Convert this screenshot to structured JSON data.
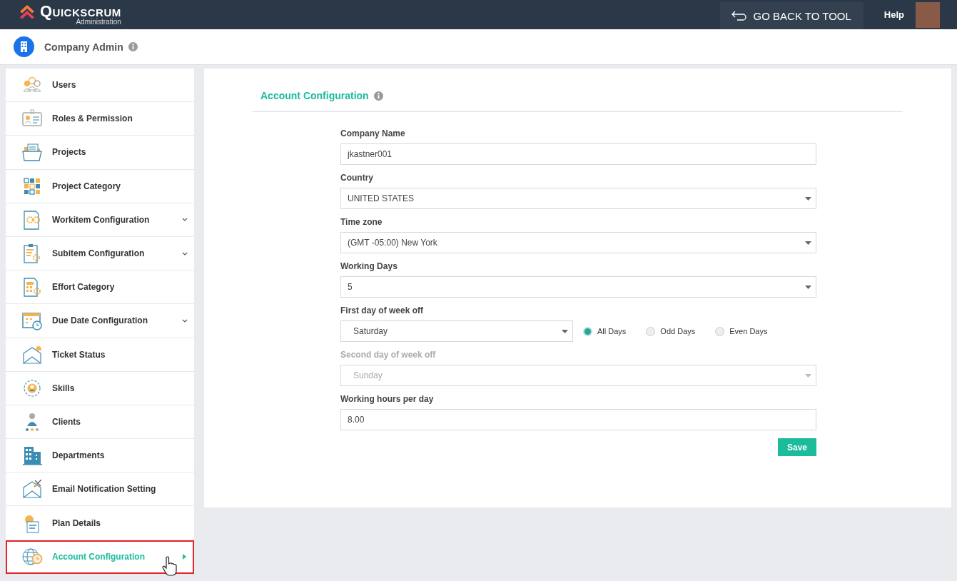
{
  "header": {
    "logo_text": "Quickscrum",
    "logo_subtitle": "Administration",
    "back_button": "GO BACK TO TOOL",
    "help_link": "Help"
  },
  "company_bar": {
    "title": "Company Admin"
  },
  "sidebar": {
    "items": [
      {
        "label": "Users",
        "expandable": false,
        "selected": false
      },
      {
        "label": "Roles & Permission",
        "expandable": false,
        "selected": false
      },
      {
        "label": "Projects",
        "expandable": false,
        "selected": false
      },
      {
        "label": "Project Category",
        "expandable": false,
        "selected": false
      },
      {
        "label": "Workitem Configuration",
        "expandable": true,
        "selected": false
      },
      {
        "label": "Subitem Configuration",
        "expandable": true,
        "selected": false
      },
      {
        "label": "Effort Category",
        "expandable": false,
        "selected": false
      },
      {
        "label": "Due Date Configuration",
        "expandable": true,
        "selected": false
      },
      {
        "label": "Ticket Status",
        "expandable": false,
        "selected": false
      },
      {
        "label": "Skills",
        "expandable": false,
        "selected": false
      },
      {
        "label": "Clients",
        "expandable": false,
        "selected": false
      },
      {
        "label": "Departments",
        "expandable": false,
        "selected": false
      },
      {
        "label": "Email Notification Setting",
        "expandable": false,
        "selected": false
      },
      {
        "label": "Plan Details",
        "expandable": false,
        "selected": false
      },
      {
        "label": "Account Configuration",
        "expandable": false,
        "selected": true
      }
    ]
  },
  "form": {
    "title": "Account Configuration",
    "fields": [
      {
        "kind": "text",
        "label": "Company Name",
        "value": "jkastner001",
        "disabled": false
      },
      {
        "kind": "select",
        "label": "Country",
        "value": "UNITED STATES",
        "disabled": false
      },
      {
        "kind": "select",
        "label": "Time zone",
        "value": "(GMT -05:00) New York",
        "disabled": false
      },
      {
        "kind": "select",
        "label": "Working Days",
        "value": "5",
        "disabled": false
      },
      {
        "kind": "select_options",
        "label": "First day of week off",
        "value": "Saturday",
        "disabled": false,
        "options": [
          {
            "label": "All Days",
            "selected": true
          },
          {
            "label": "Odd Days",
            "selected": false
          },
          {
            "label": "Even Days",
            "selected": false
          }
        ]
      },
      {
        "kind": "select",
        "label": "Second day of week off",
        "value": "Sunday",
        "disabled": true
      },
      {
        "kind": "text",
        "label": "Working hours per day",
        "value": "8.00",
        "disabled": false
      }
    ],
    "save_button": "Save"
  }
}
